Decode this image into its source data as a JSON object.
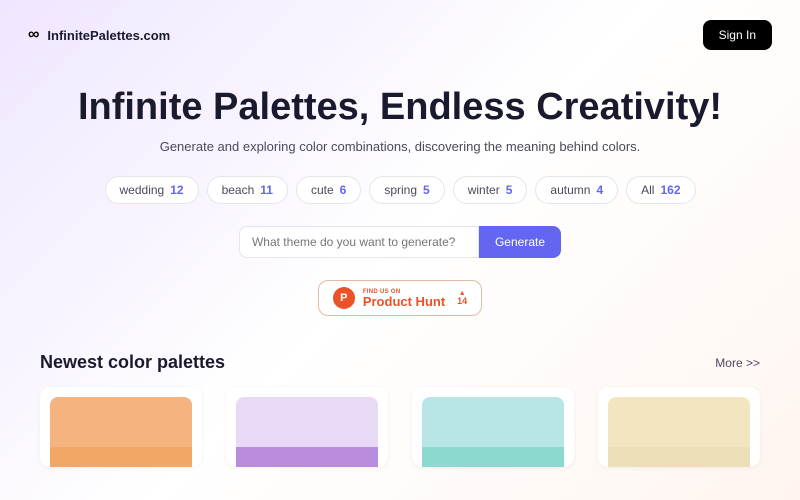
{
  "header": {
    "brand": "InfinitePalettes.com",
    "signin": "Sign In"
  },
  "hero": {
    "title": "Infinite Palettes, Endless Creativity!",
    "subtitle": "Generate and exploring color combinations, discovering the meaning behind colors."
  },
  "tags": [
    {
      "label": "wedding",
      "count": "12"
    },
    {
      "label": "beach",
      "count": "11"
    },
    {
      "label": "cute",
      "count": "6"
    },
    {
      "label": "spring",
      "count": "5"
    },
    {
      "label": "winter",
      "count": "5"
    },
    {
      "label": "autumn",
      "count": "4"
    },
    {
      "label": "All",
      "count": "162"
    }
  ],
  "search": {
    "placeholder": "What theme do you want to generate?",
    "button": "Generate"
  },
  "producthunt": {
    "p": "P",
    "top": "FIND US ON",
    "main": "Product Hunt",
    "votes": "14"
  },
  "section": {
    "title": "Newest color palettes",
    "more": "More >>"
  },
  "palettes": [
    {
      "c1": "#f5b380",
      "c2": "#f2a766"
    },
    {
      "c1": "#e8d9f7",
      "c2": "#b98cde"
    },
    {
      "c1": "#b8e5e5",
      "c2": "#8cd9cf"
    },
    {
      "c1": "#f2e5c0",
      "c2": "#ede0b8"
    }
  ]
}
